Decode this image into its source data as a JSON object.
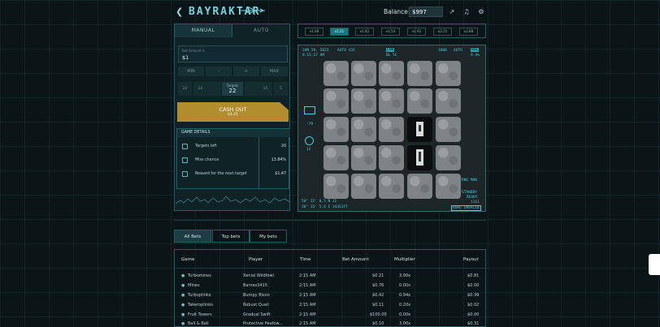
{
  "header": {
    "logo": "BAYRAKTAR",
    "balance_label": "Balance:",
    "balance_value": "$997"
  },
  "left_panel": {
    "tabs": [
      "MANUAL",
      "AUTO"
    ],
    "bet_label": "Bet Amount $",
    "bet_value": "$1",
    "buttons": [
      "MIN",
      "-",
      "+",
      "MAX"
    ],
    "chips": [
      "22",
      "20",
      "20",
      "15",
      "5"
    ],
    "target_label": "Targets",
    "target_value": "22",
    "cash_out": "CASH OUT",
    "cash_out_amount": "$1.21",
    "details_title": "GAME DETAILS",
    "details": [
      {
        "icon": "plane-icon",
        "label": "Targets left",
        "value": "20"
      },
      {
        "icon": "square-icon",
        "label": "Miss chance",
        "value": "13.84%"
      },
      {
        "icon": "grid-icon",
        "label": "Reward for the next target",
        "value": "$1.47"
      }
    ]
  },
  "multipliers": [
    "x1.08",
    "x1.21",
    "x1.42",
    "x1.54",
    "x1.92",
    "x2.25",
    "x2.68"
  ],
  "multiplier_selected": "x1.21",
  "game": {
    "hud_date": "JUN 28, 2023",
    "hud_time": "8:15:17 AM",
    "hud_mode": "AUTO",
    "hud_vic": "VIC",
    "hud_con": "CON",
    "hud_bl": "BL 5C",
    "hud_1000": "1000",
    "hud_auto2": "AUTO",
    "hud_rec": "REC",
    "hud_9": "9.4%",
    "hud_side_a": "-79",
    "hud_side_b": "12",
    "hud_rng": "RNG MAN",
    "hud_standby": "STANDBY",
    "hud_ready": "READY",
    "hud_1111": "1111",
    "hud_bore": "BORE INVALID",
    "hud_coord1": "50° 22' 8.5 N   12",
    "hud_coord2": "36° 15' 5.4 E   14413FT"
  },
  "bets": {
    "tabs": [
      "All Bets",
      "Top bets",
      "My bets"
    ],
    "columns": [
      "Game",
      "Player",
      "Time",
      "Bet Amount",
      "Multiplier",
      "Payout"
    ],
    "rows": [
      [
        "Turbomines",
        "Xenial Wildfowl",
        "2:15 AM",
        "$0.21",
        "3.90x",
        "$0.81"
      ],
      [
        "Mines",
        "Barnes3415",
        "2:15 AM",
        "$0.76",
        "0.00x",
        "$0.00"
      ],
      [
        "Turboplinko",
        "Bumpy Bison",
        "2:15 AM",
        "$0.42",
        "0.94x",
        "$0.39"
      ],
      [
        "Takeroplinko",
        "Robust Quail",
        "2:15 AM",
        "$0.11",
        "0.20x",
        "$0.02"
      ],
      [
        "Fruit Towers",
        "Gradual Swift",
        "2:15 AM",
        "$100.00",
        "0.00x",
        "$0.00"
      ],
      [
        "Ball & Ball",
        "Protective Peafow...",
        "2:15 AM",
        "$0.10",
        "3.00x",
        "$0.31"
      ]
    ]
  },
  "colors": {
    "accent": "#1a7880",
    "cash": "#b18d2e",
    "hud": "#3fd0e3"
  }
}
